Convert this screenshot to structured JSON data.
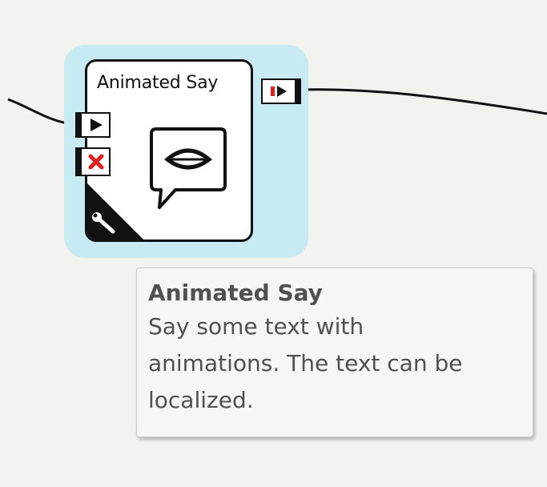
{
  "box": {
    "title": "Animated Say",
    "icon": "speech-bubble-mouth-icon",
    "corner_icon": "wrench-icon"
  },
  "ports": {
    "input": {
      "icon": "play-icon"
    },
    "stop": {
      "icon": "stop-x-icon",
      "color": "#e0201e"
    },
    "output": {
      "icon": "signal-out-icon",
      "color": "#e0201e"
    }
  },
  "tooltip": {
    "title": "Animated Say",
    "line1": "Say some text with",
    "line2": "animations. The text can be",
    "line3": "localized."
  },
  "colors": {
    "canvas": "#f2f2ef",
    "selection": "#c8eaf3",
    "tooltip_text": "#505050"
  }
}
